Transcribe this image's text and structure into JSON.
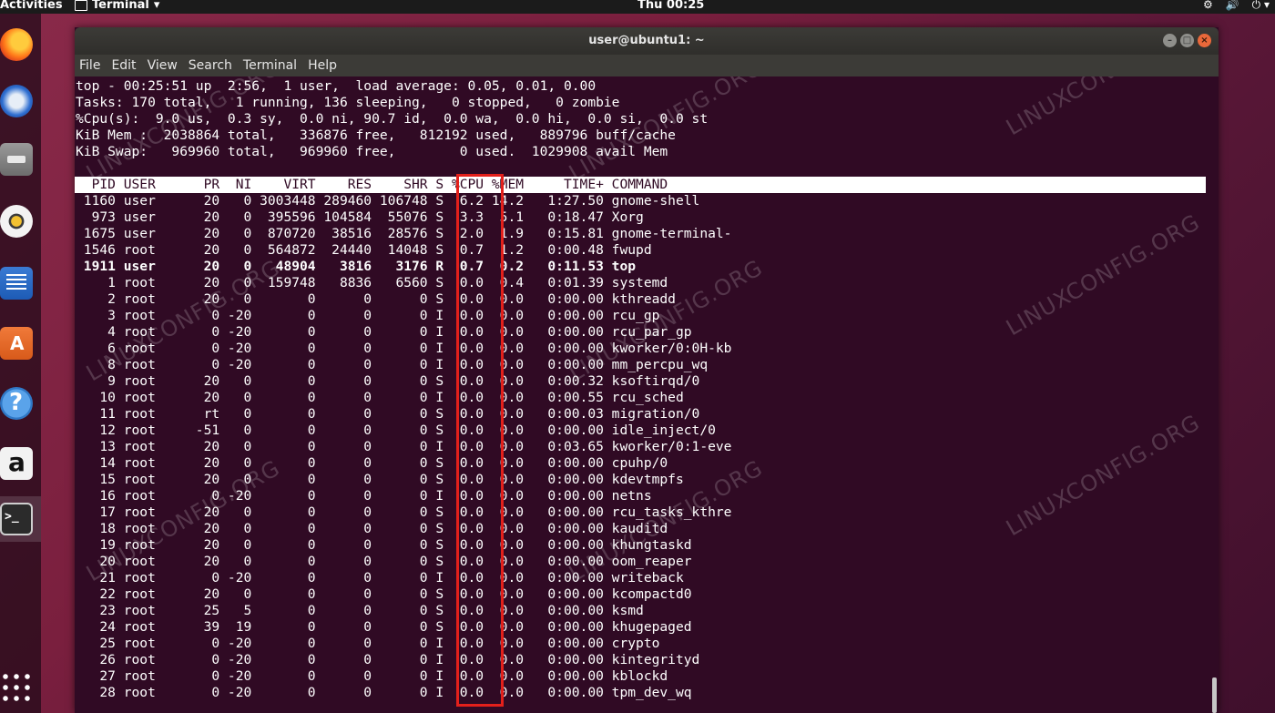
{
  "topbar": {
    "activities": "Activities",
    "app_name": "Terminal",
    "app_caret": "▾",
    "clock": "Thu 00:25",
    "tray": [
      "⚙",
      "🔊",
      "⏻ ▾"
    ]
  },
  "window": {
    "title": "user@ubuntu1: ~",
    "controls": [
      "–",
      "□",
      "×"
    ]
  },
  "menu": [
    "File",
    "Edit",
    "View",
    "Search",
    "Terminal",
    "Help"
  ],
  "summary": [
    "top - 00:25:51 up  2:56,  1 user,  load average: 0.05, 0.01, 0.00",
    "Tasks: 170 total,   1 running, 136 sleeping,   0 stopped,   0 zombie",
    "%Cpu(s):  9.0 us,  0.3 sy,  0.0 ni, 90.7 id,  0.0 wa,  0.0 hi,  0.0 si,  0.0 st",
    "KiB Mem :  2038864 total,   336876 free,   812192 used,   889796 buff/cache",
    "KiB Swap:   969960 total,   969960 free,        0 used.  1029908 avail Mem"
  ],
  "header": "  PID USER      PR  NI    VIRT    RES    SHR S %CPU %MEM     TIME+ COMMAND",
  "rows": [
    " 1160 user      20   0 3003448 289460 106748 S  6.2 14.2   1:27.50 gnome-shell",
    "  973 user      20   0  395596 104584  55076 S  3.3  5.1   0:18.47 Xorg",
    " 1675 user      20   0  870720  38516  28576 S  2.0  1.9   0:15.81 gnome-terminal-",
    " 1546 root      20   0  564872  24440  14048 S  0.7  1.2   0:00.48 fwupd",
    " 1911 user      20   0   48904   3816   3176 R  0.7  0.2   0:11.53 top",
    "    1 root      20   0  159748   8836   6560 S  0.0  0.4   0:01.39 systemd",
    "    2 root      20   0       0      0      0 S  0.0  0.0   0:00.00 kthreadd",
    "    3 root       0 -20       0      0      0 I  0.0  0.0   0:00.00 rcu_gp",
    "    4 root       0 -20       0      0      0 I  0.0  0.0   0:00.00 rcu_par_gp",
    "    6 root       0 -20       0      0      0 I  0.0  0.0   0:00.00 kworker/0:0H-kb",
    "    8 root       0 -20       0      0      0 I  0.0  0.0   0:00.00 mm_percpu_wq",
    "    9 root      20   0       0      0      0 S  0.0  0.0   0:00.32 ksoftirqd/0",
    "   10 root      20   0       0      0      0 I  0.0  0.0   0:00.55 rcu_sched",
    "   11 root      rt   0       0      0      0 S  0.0  0.0   0:00.03 migration/0",
    "   12 root     -51   0       0      0      0 S  0.0  0.0   0:00.00 idle_inject/0",
    "   13 root      20   0       0      0      0 I  0.0  0.0   0:03.65 kworker/0:1-eve",
    "   14 root      20   0       0      0      0 S  0.0  0.0   0:00.00 cpuhp/0",
    "   15 root      20   0       0      0      0 S  0.0  0.0   0:00.00 kdevtmpfs",
    "   16 root       0 -20       0      0      0 I  0.0  0.0   0:00.00 netns",
    "   17 root      20   0       0      0      0 S  0.0  0.0   0:00.00 rcu_tasks_kthre",
    "   18 root      20   0       0      0      0 S  0.0  0.0   0:00.00 kauditd",
    "   19 root      20   0       0      0      0 S  0.0  0.0   0:00.00 khungtaskd",
    "   20 root      20   0       0      0      0 S  0.0  0.0   0:00.00 oom_reaper",
    "   21 root       0 -20       0      0      0 I  0.0  0.0   0:00.00 writeback",
    "   22 root      20   0       0      0      0 S  0.0  0.0   0:00.00 kcompactd0",
    "   23 root      25   5       0      0      0 S  0.0  0.0   0:00.00 ksmd",
    "   24 root      39  19       0      0      0 S  0.0  0.0   0:00.00 khugepaged",
    "   25 root       0 -20       0      0      0 I  0.0  0.0   0:00.00 crypto",
    "   26 root       0 -20       0      0      0 I  0.0  0.0   0:00.00 kintegrityd",
    "   27 root       0 -20       0      0      0 I  0.0  0.0   0:00.00 kblockd",
    "   28 root       0 -20       0      0      0 I  0.0  0.0   0:00.00 tpm_dev_wq"
  ],
  "bold_row_index": 4,
  "watermark": "LINUXCONFIG.ORG",
  "colors": {
    "terminal_bg": "#300a24",
    "highlight_box": "#e3201b",
    "close_button": "#e9683a"
  }
}
